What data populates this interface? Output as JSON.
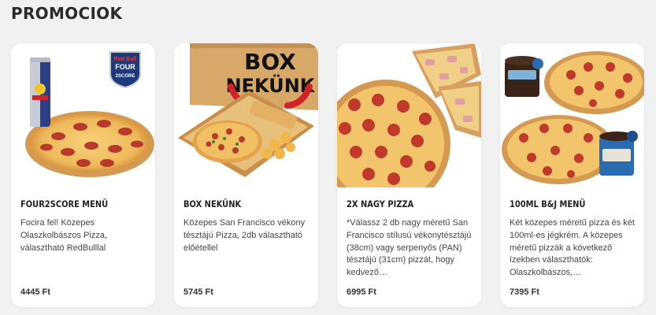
{
  "section": {
    "title": "PROMOCIOK"
  },
  "promos": [
    {
      "name": "FOUR2SCORE MENÜ",
      "description": "Focira fel! Közepes Olaszkolbászos Pizza, választható RedBulllal",
      "price": "4445 Ft",
      "badge_line1": "Red Bull",
      "badge_line2": "FOUR",
      "badge_line3": "2SCORE",
      "image": "pizza-with-redbull-can"
    },
    {
      "name": "BOX NEKÜNK",
      "description": "Közepes San Francisco vékony tésztájú Pizza, 2db választható előétellel",
      "price": "5745 Ft",
      "box_line1": "BOX",
      "box_line2": "NEKÜNK",
      "image": "pizza-box-with-sides"
    },
    {
      "name": "2X NAGY PIZZA",
      "description": "*Válassz 2 db nagy méretű San Francisco stílusú vékonytésztájú (38cm) vagy serpenyős (PAN) tésztájú (31cm) pizzát, hogy kedvező…",
      "price": "6995 Ft",
      "image": "two-large-pizzas"
    },
    {
      "name": "100ML B&J MENÜ",
      "description": "Két közepes méretű pizza és két 100ml-es jégkrém. A közepes méretű pizzák a következő ízekben választhatók: Olaszkolbászos,…",
      "price": "7395 Ft",
      "image": "pizzas-with-ice-cream-tubs"
    }
  ],
  "colors": {
    "background": "#f1f1f1",
    "card": "#ffffff",
    "pepperoni": "#c0392b",
    "cheese": "#f3c56a",
    "crust": "#d9a05b",
    "redbull_blue": "#1f3a7a"
  }
}
